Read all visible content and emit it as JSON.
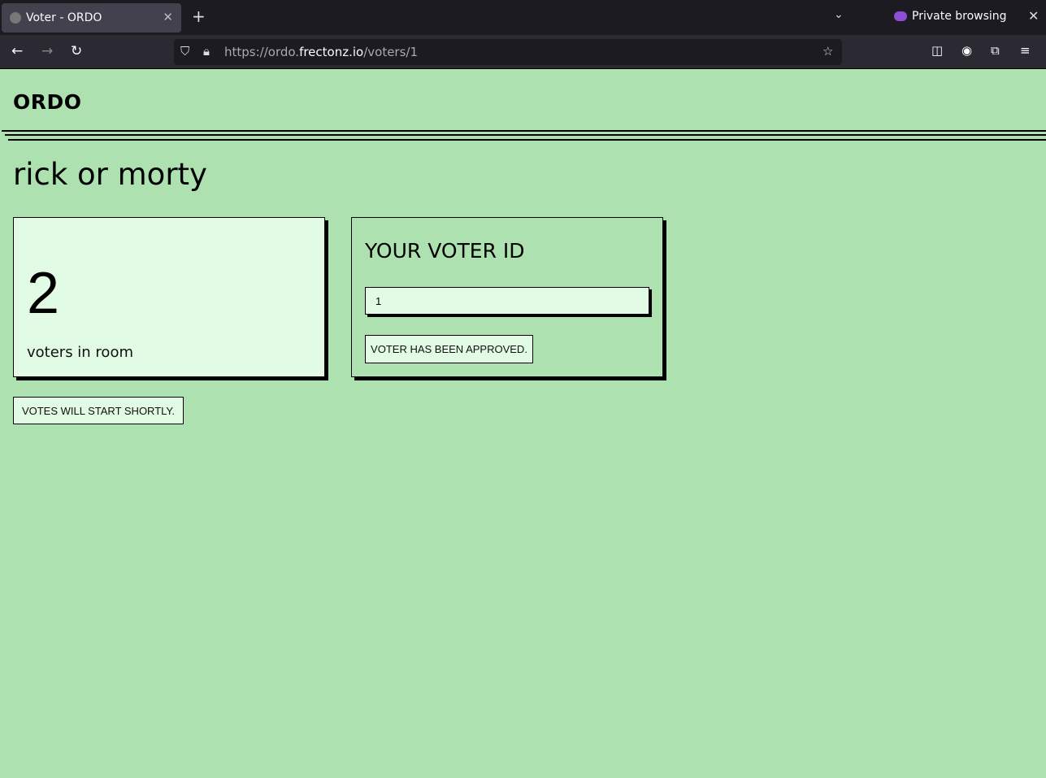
{
  "browser": {
    "tab_title": "Voter - ORDO",
    "private_label": "Private browsing",
    "url_prefix": "https://ordo.",
    "url_domain": "frectonz.io",
    "url_path": "/voters/1"
  },
  "app": {
    "brand": "ORDO",
    "room_title": "rick or morty"
  },
  "voters": {
    "count": "2",
    "label": "voters in room"
  },
  "voter_id": {
    "heading": "YOUR VOTER ID",
    "value": "1",
    "status": "VOTER HAS BEEN APPROVED."
  },
  "status": "VOTES WILL START SHORTLY.",
  "colors": {
    "background": "#ade1b0",
    "card": "#e2fbe4"
  }
}
